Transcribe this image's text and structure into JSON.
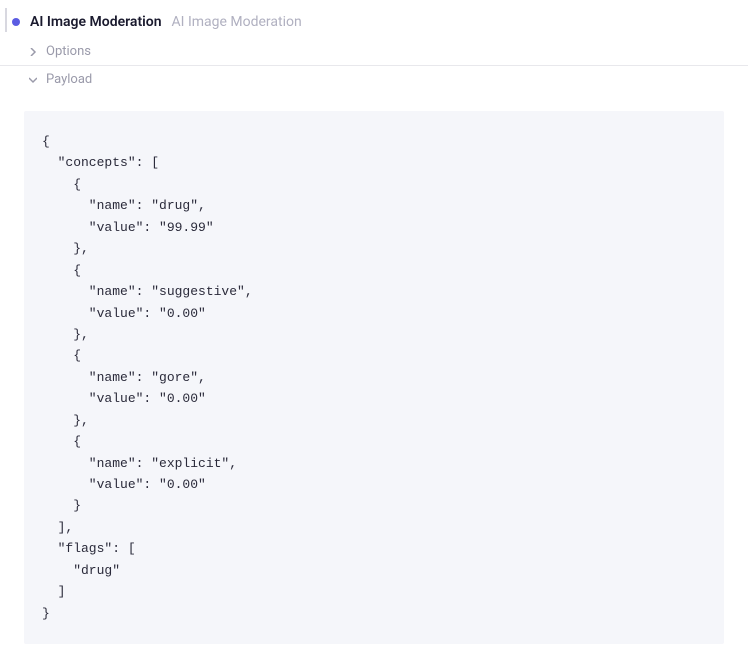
{
  "header": {
    "title_bold": "AI Image Moderation",
    "title_light": "AI Image Moderation"
  },
  "sections": {
    "options_label": "Options",
    "payload_label": "Payload"
  },
  "payload": {
    "concepts": [
      {
        "name": "drug",
        "value": "99.99"
      },
      {
        "name": "suggestive",
        "value": "0.00"
      },
      {
        "name": "gore",
        "value": "0.00"
      },
      {
        "name": "explicit",
        "value": "0.00"
      }
    ],
    "flags": [
      "drug"
    ]
  }
}
